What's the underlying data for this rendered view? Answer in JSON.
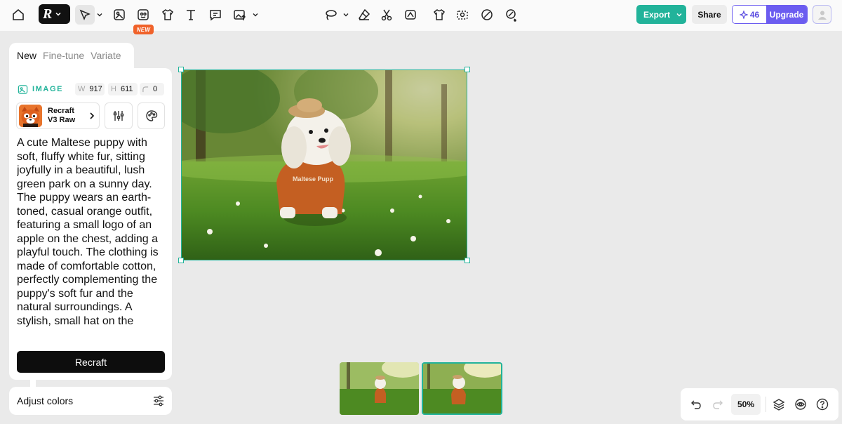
{
  "toolbar": {
    "tools": [
      {
        "name": "home-icon"
      },
      {
        "name": "brand-logo-icon"
      },
      {
        "name": "select-arrow-icon"
      },
      {
        "name": "image-frame-icon"
      },
      {
        "name": "photo-tool-icon"
      },
      {
        "name": "tshirt-mockup-icon"
      },
      {
        "name": "text-icon"
      },
      {
        "name": "comment-icon"
      },
      {
        "name": "image-upload-icon"
      },
      {
        "name": "lasso-icon"
      },
      {
        "name": "eraser-icon"
      },
      {
        "name": "scissors-icon"
      },
      {
        "name": "vectorize-icon"
      },
      {
        "name": "shirt-icon"
      },
      {
        "name": "background-remove-icon"
      },
      {
        "name": "brush-icon"
      },
      {
        "name": "magic-edit-icon"
      }
    ],
    "new_badge": "NEW",
    "export_label": "Export",
    "share_label": "Share",
    "credits": "46",
    "upgrade_label": "Upgrade"
  },
  "panel": {
    "tabs": [
      {
        "label": "New",
        "active": true
      },
      {
        "label": "Fine-tune",
        "active": false
      },
      {
        "label": "Variate",
        "active": false
      }
    ],
    "image_label": "IMAGE",
    "width_key": "W",
    "width_value": "917",
    "height_key": "H",
    "height_value": "611",
    "corner_value": "0",
    "model_name": "Recraft V3 Raw",
    "prompt": "A cute Maltese puppy with soft, fluffy white fur, sitting joyfully in a beautiful, lush green park on a sunny day. The puppy wears an earth-toned, casual orange outfit, featuring a small logo of an apple on the chest, adding a playful touch. The clothing is made of comfortable cotton, perfectly complementing the puppy's soft fur and the natural surroundings. A stylish, small hat on the",
    "recraft_label": "Recraft",
    "adjust_label": "Adjust colors"
  },
  "canvas": {
    "image_text": "Maltese Pupp"
  },
  "footer": {
    "zoom": "50%"
  },
  "colors": {
    "accent": "#22b39a",
    "upgrade": "#6b5cf0",
    "badge": "#f0622a"
  }
}
